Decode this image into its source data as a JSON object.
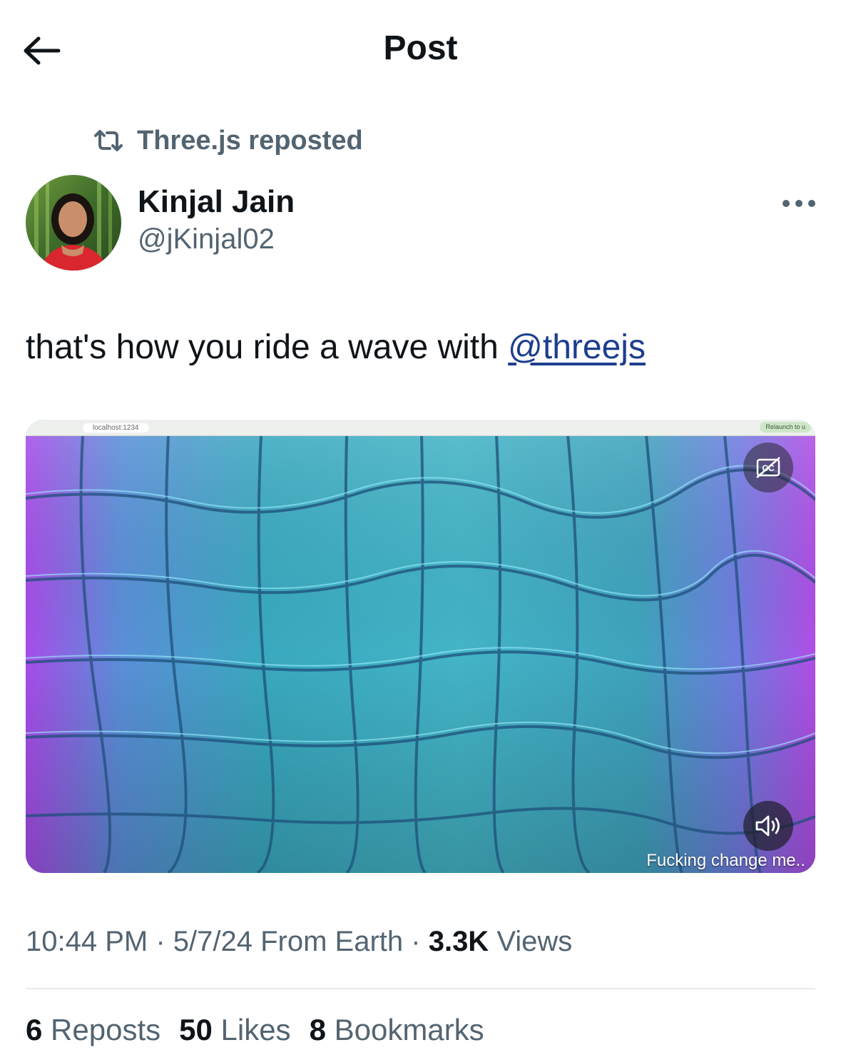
{
  "header": {
    "title": "Post",
    "back_icon": "arrow-left-icon"
  },
  "repost": {
    "icon": "repost-icon",
    "text": "Three.js reposted"
  },
  "author": {
    "name": "Kinjal Jain",
    "handle": "@jKinjal02"
  },
  "post": {
    "text_prefix": "that's how you ride a wave with ",
    "mention": "@threejs"
  },
  "media": {
    "browser_url": "localhost:1234",
    "browser_button": "Relaunch to u",
    "caption": "Fucking change me..",
    "cc_icon": "captions-off-icon",
    "sound_icon": "volume-icon"
  },
  "meta": {
    "time": "10:44 PM",
    "date": "5/7/24",
    "location": "From Earth",
    "views_count": "3.3K",
    "views_label": "Views"
  },
  "stats": [
    {
      "count": "6",
      "label": "Reposts"
    },
    {
      "count": "50",
      "label": "Likes"
    },
    {
      "count": "8",
      "label": "Bookmarks"
    }
  ],
  "colors": {
    "secondary_text": "#536471",
    "mention": "#1d3d8f",
    "primary_text": "#0f1419"
  }
}
